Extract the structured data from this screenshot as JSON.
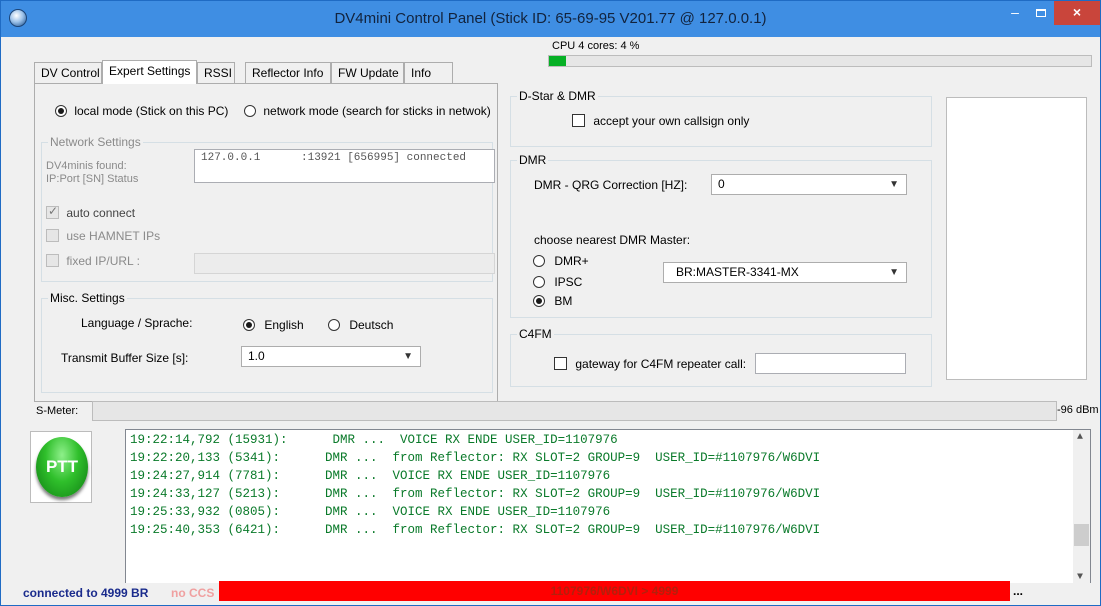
{
  "window": {
    "title": "DV4mini Control Panel (Stick  ID: 65-69-95 V201.77 @ 127.0.0.1)",
    "min_label": "–",
    "close_label": "×"
  },
  "tabs": [
    {
      "label": "DV Control"
    },
    {
      "label": "Expert Settings",
      "active": true
    },
    {
      "label": "RSSI"
    },
    {
      "label": "Reflector Info"
    },
    {
      "label": "FW Update"
    },
    {
      "label": "Info"
    }
  ],
  "cpu": {
    "label": "CPU 4 cores: 4 %",
    "percent": 4
  },
  "mode": {
    "local_label": "local mode (Stick on this PC)",
    "network_label": "network mode (search for sticks in netwok)",
    "selected": "local"
  },
  "network_settings": {
    "group_label": "Network Settings",
    "found_label_1": "DV4minis found:",
    "found_label_2": "IP:Port [SN] Status",
    "found_entry_ip": "127.0.0.1",
    "found_entry_rest": ":13921 [656995] connected",
    "auto_connect_label": "auto connect",
    "hamnet_label": "use HAMNET IPs",
    "fixed_ip_label": "fixed IP/URL :"
  },
  "misc": {
    "group_label": "Misc. Settings",
    "language_label": "Language / Sprache:",
    "english_label": "English",
    "deutsch_label": "Deutsch",
    "selected_language": "English",
    "buffer_label": "Transmit Buffer Size [s]:",
    "buffer_value": "1.0"
  },
  "dstar_dmr": {
    "group_label": "D-Star & DMR",
    "own_callsign_label": "accept your own callsign only"
  },
  "dmr": {
    "group_label": "DMR",
    "qrg_label": "DMR - QRG Correction [HZ]:",
    "qrg_value": "0",
    "master_label": "choose nearest DMR Master:",
    "options": [
      "DMR+",
      "IPSC",
      "BM"
    ],
    "selected": "BM",
    "master_value": "BR:MASTER-3341-MX"
  },
  "c4fm": {
    "group_label": "C4FM",
    "gateway_label": "gateway for C4FM repeater call:"
  },
  "smeter": {
    "label": "S-Meter:",
    "value": "-96 dBm"
  },
  "ptt": {
    "label": "PTT"
  },
  "log": [
    "19:22:14,792 (15931):      DMR ...  VOICE RX ENDE USER_ID=1107976",
    "19:22:20,133 (5341):      DMR ...  from Reflector: RX SLOT=2 GROUP=9  USER_ID=#1107976/W6DVI",
    "19:24:27,914 (7781):      DMR ...  VOICE RX ENDE USER_ID=1107976",
    "19:24:33,127 (5213):      DMR ...  from Reflector: RX SLOT=2 GROUP=9  USER_ID=#1107976/W6DVI",
    "19:25:33,932 (0805):      DMR ...  VOICE RX ENDE USER_ID=1107976",
    "19:25:40,353 (6421):      DMR ...  from Reflector: RX SLOT=2 GROUP=9  USER_ID=#1107976/W6DVI"
  ],
  "status": {
    "connected": "connected to 4999 BR",
    "ccs": "no CCS",
    "last_heard": "1107976/W6DVI > 4999",
    "more": "..."
  },
  "colors": {
    "log_text": "#0a7a2a",
    "status_red": "#ff0000",
    "connected_text": "#1a2b8c",
    "ccs_text": "#f0a0a0"
  }
}
